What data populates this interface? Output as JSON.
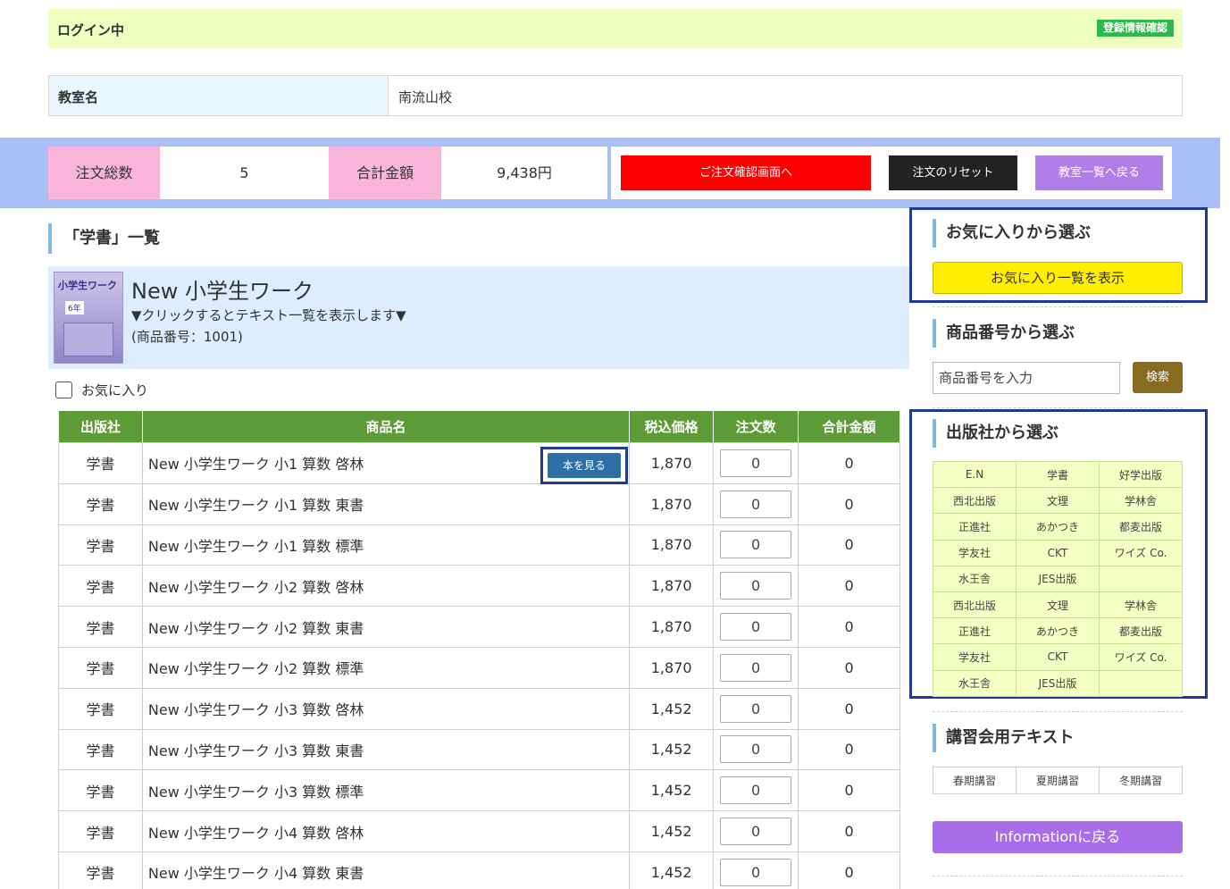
{
  "login": {
    "status": "ログイン中",
    "register_link": "登録情報確認"
  },
  "classroom": {
    "label": "教室名",
    "value": "南流山校"
  },
  "summary": {
    "count_label": "注文総数",
    "count_value": "5",
    "total_label": "合計金額",
    "total_value": "9,438円",
    "confirm_button": "ご注文確認画面へ",
    "reset_button": "注文のリセット",
    "back_button": "教室一覧へ戻る"
  },
  "section_title": "「学書」一覧",
  "product": {
    "cover_title": "小学生ワーク",
    "cover_grade": "6年",
    "name": "New 小学生ワーク",
    "hint": "▼クリックするとテキスト一覧を表示します▼",
    "number": "(商品番号：1001)"
  },
  "favorite_label": "お気に入り",
  "table": {
    "headers": [
      "出版社",
      "商品名",
      "税込価格",
      "注文数",
      "合計金額"
    ],
    "view_button": "本を見る",
    "rows": [
      {
        "publisher": "学書",
        "name": "New 小学生ワーク 小1 算数 啓林",
        "price": "1,870",
        "qty": "0",
        "total": "0"
      },
      {
        "publisher": "学書",
        "name": "New 小学生ワーク 小1 算数 東書",
        "price": "1,870",
        "qty": "0",
        "total": "0"
      },
      {
        "publisher": "学書",
        "name": "New 小学生ワーク 小1 算数 標準",
        "price": "1,870",
        "qty": "0",
        "total": "0"
      },
      {
        "publisher": "学書",
        "name": "New 小学生ワーク 小2 算数 啓林",
        "price": "1,870",
        "qty": "0",
        "total": "0"
      },
      {
        "publisher": "学書",
        "name": "New 小学生ワーク 小2 算数 東書",
        "price": "1,870",
        "qty": "0",
        "total": "0"
      },
      {
        "publisher": "学書",
        "name": "New 小学生ワーク 小2 算数 標準",
        "price": "1,870",
        "qty": "0",
        "total": "0"
      },
      {
        "publisher": "学書",
        "name": "New 小学生ワーク 小3 算数 啓林",
        "price": "1,452",
        "qty": "0",
        "total": "0"
      },
      {
        "publisher": "学書",
        "name": "New 小学生ワーク 小3 算数 東書",
        "price": "1,452",
        "qty": "0",
        "total": "0"
      },
      {
        "publisher": "学書",
        "name": "New 小学生ワーク 小3 算数 標準",
        "price": "1,452",
        "qty": "0",
        "total": "0"
      },
      {
        "publisher": "学書",
        "name": "New 小学生ワーク 小4 算数 啓林",
        "price": "1,452",
        "qty": "0",
        "total": "0"
      },
      {
        "publisher": "学書",
        "name": "New 小学生ワーク 小4 算数 東書",
        "price": "1,452",
        "qty": "0",
        "total": "0"
      }
    ]
  },
  "sidebar": {
    "favorites_title": "お気に入りから選ぶ",
    "favorites_button": "お気に入り一覧を表示",
    "number_title": "商品番号から選ぶ",
    "number_placeholder": "商品番号を入力",
    "search_button": "検索",
    "publisher_title": "出版社から選ぶ",
    "publishers": [
      [
        "E.N",
        "学書",
        "好学出版"
      ],
      [
        "西北出版",
        "文理",
        "学林舎"
      ],
      [
        "正進社",
        "あかつき",
        "都麦出版"
      ],
      [
        "学友社",
        "CKT",
        "ワイズ Co."
      ],
      [
        "水王舎",
        "JES出版",
        ""
      ],
      [
        "西北出版",
        "文理",
        "学林舎"
      ],
      [
        "正進社",
        "あかつき",
        "都麦出版"
      ],
      [
        "学友社",
        "CKT",
        "ワイズ Co."
      ],
      [
        "水王舎",
        "JES出版",
        ""
      ]
    ],
    "lecture_title": "講習会用テキスト",
    "lectures": [
      "春期講習",
      "夏期講習",
      "冬期講習"
    ],
    "info_button": "Informationに戻る"
  },
  "colors": {
    "login_bg": "#efffc0",
    "summary_bg": "#a9bff5",
    "pink": "#f9b4d9",
    "table_header": "#5c9b36",
    "confirm": "#ff0000",
    "highlight": "#1e3a98"
  }
}
